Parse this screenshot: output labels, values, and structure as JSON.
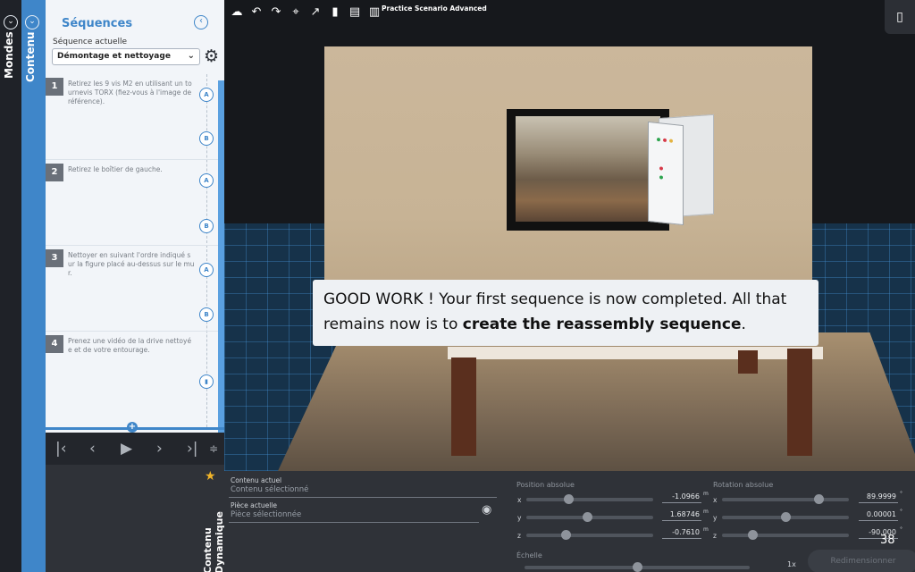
{
  "rails": {
    "mondes_label": "Mondes",
    "contenu_label": "Contenu",
    "toggle_glyph": "⌄"
  },
  "panel": {
    "title": "Séquences",
    "back_glyph": "‹",
    "sequence_label": "Séquence actuelle",
    "sequence_value": "Démontage et nettoyage",
    "steps": [
      {
        "num": "1",
        "text": "Retirez les 9 vis M2 en utilisant un tournevis TORX (fiez-vous à l'image de référence).",
        "nodes": [
          "A",
          "B"
        ]
      },
      {
        "num": "2",
        "text": "Retirez le boîtier de gauche.",
        "nodes": [
          "A",
          "B"
        ]
      },
      {
        "num": "3",
        "text": "Nettoyer en suivant l'ordre indiqué sur la figure placé au-dessus sur le mur.",
        "nodes": [
          "A",
          "B"
        ]
      },
      {
        "num": "4",
        "text": "Prenez une vidéo de la drive nettoyée et de votre entourage.",
        "nodes": [
          "camera"
        ]
      }
    ],
    "add_glyph": "+"
  },
  "playback": {
    "first": "⏮",
    "prev": "‹",
    "play": "▶",
    "next": "›",
    "last": "⏭",
    "more": "≑"
  },
  "dynamic": {
    "label": "Contenu Dynamique",
    "star_glyph": "★"
  },
  "viewport": {
    "scenario_title": "Practice Scenario Advanced",
    "toolbar_icons": [
      "cloud-upload-icon",
      "undo-icon",
      "redo-icon",
      "focus-icon",
      "share-icon",
      "video-icon",
      "book-icon",
      "chart-icon"
    ],
    "toolbar_glyphs": [
      "☁",
      "↶",
      "↷",
      "⌖",
      "↗",
      "▮",
      "▤",
      "▥"
    ],
    "device_glyph": "▯"
  },
  "toast": {
    "part1": "GOOD WORK ! Your first sequence is now completed. All that remains now is to ",
    "bold": "create the reassembly sequence",
    "part2": "."
  },
  "props": {
    "current_content_label": "Contenu actuel",
    "current_content_value": "Contenu sélectionné",
    "current_piece_label": "Pièce actuelle",
    "current_piece_value": "Pièce sélectionnée",
    "position_title": "Position absolue",
    "rotation_title": "Rotation absolue",
    "scale_title": "Échelle",
    "position": [
      {
        "axis": "x",
        "value": "-1.0966",
        "unit": "m",
        "level": 0.33
      },
      {
        "axis": "y",
        "value": "1.68746",
        "unit": "m",
        "level": 0.48
      },
      {
        "axis": "z",
        "value": "-0.7610",
        "unit": "m",
        "level": 0.31
      }
    ],
    "rotation": [
      {
        "axis": "x",
        "value": "89.9999",
        "unit": "°",
        "level": 0.76
      },
      {
        "axis": "y",
        "value": "0.00001",
        "unit": "°",
        "level": 0.5
      },
      {
        "axis": "z",
        "value": "-90.000",
        "unit": "°",
        "level": 0.24
      }
    ],
    "scale_level": 0.5,
    "zoom": "1x",
    "page_number": "38",
    "resize_label": "Redimensionner"
  }
}
